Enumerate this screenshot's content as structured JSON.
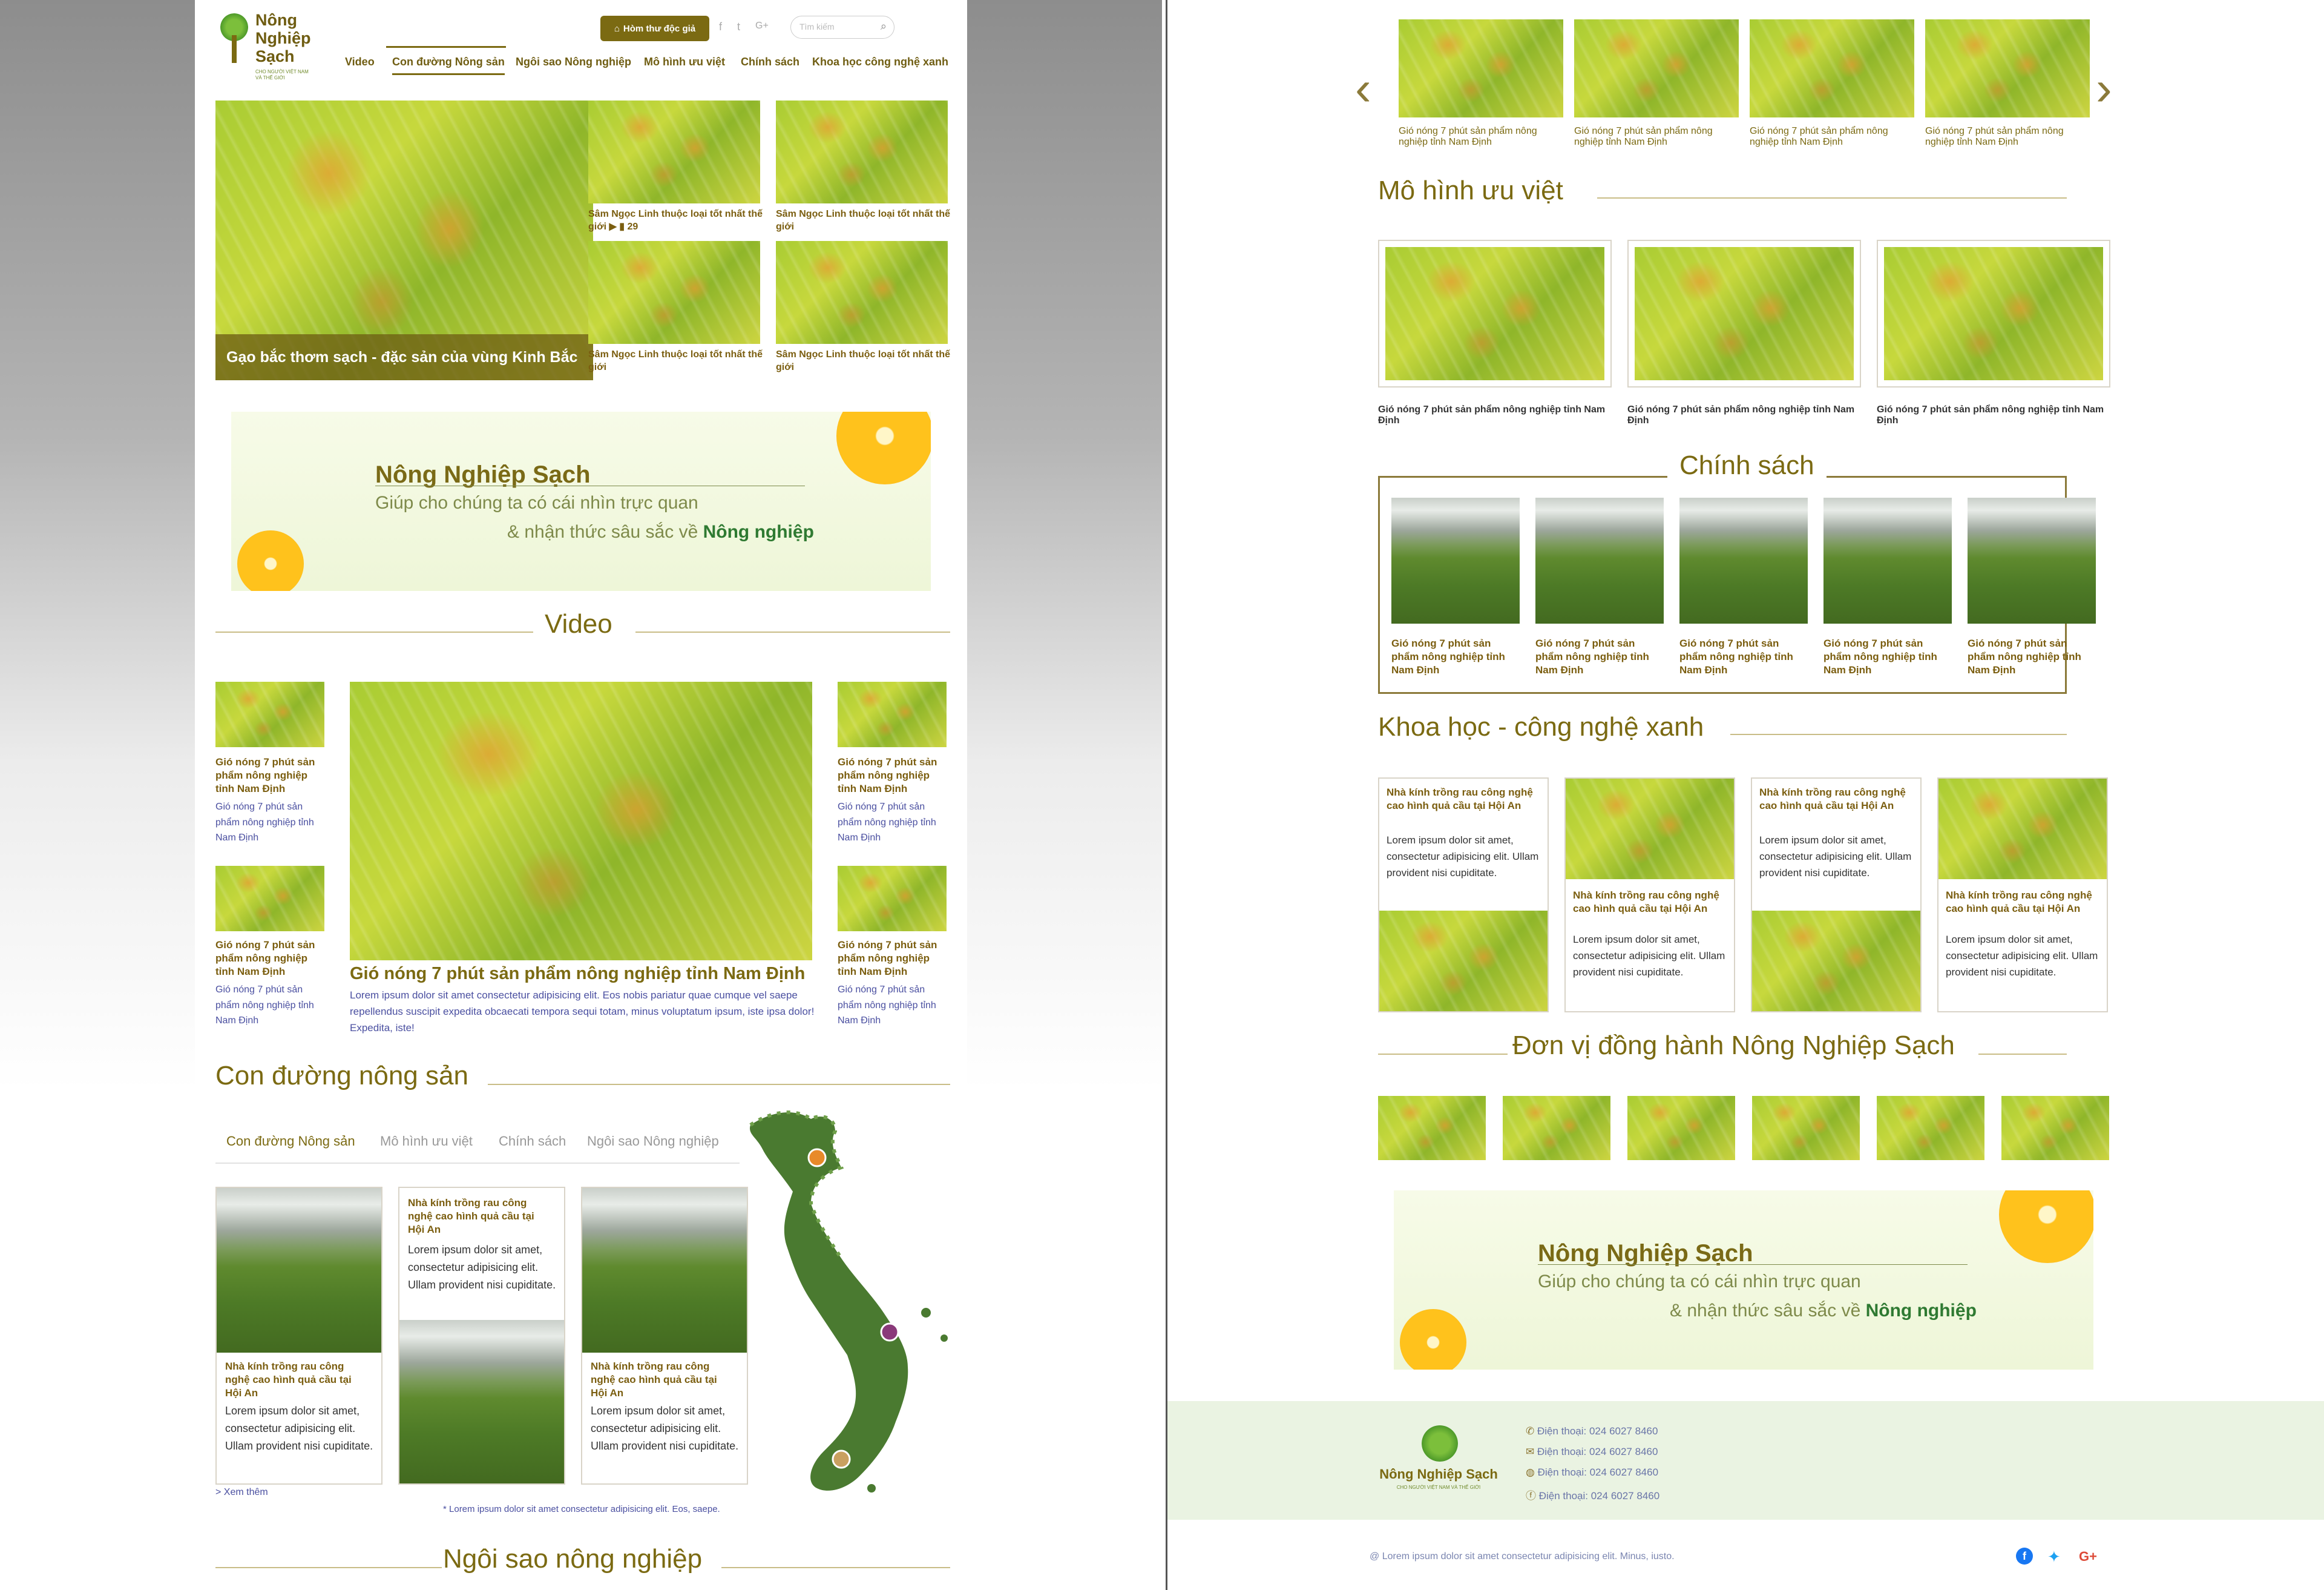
{
  "brand": {
    "name": "Nông Nghiệp Sạch",
    "name_line1": "Nông",
    "name_line2": "Nghiệp",
    "name_line3": "Sạch",
    "tagline": "CHO NGƯỜI VIỆT NAM VÀ THẾ GIỚI"
  },
  "header": {
    "mailbox_label": "Hòm thư độc giả",
    "search_placeholder": "Tìm kiếm"
  },
  "nav": {
    "items": [
      "Video",
      "Con đường Nông sản",
      "Ngôi sao Nông nghiệp",
      "Mô hình ưu việt",
      "Chính sách",
      "Khoa học công nghệ xanh"
    ],
    "active_index": 1
  },
  "hero": {
    "caption": "Gạo bắc thơm sạch - đặc sản của vùng Kinh Bắc",
    "grid": [
      {
        "title": "Sâm Ngọc Linh thuộc loại tốt nhất thế giới",
        "comments": "29"
      },
      {
        "title": "Sâm Ngọc Linh thuộc loại tốt nhất thế giới"
      },
      {
        "title": "Sâm Ngọc Linh thuộc loại tốt nhất thế giới"
      },
      {
        "title": "Sâm Ngọc Linh thuộc loại tốt nhất thế giới"
      }
    ]
  },
  "banner": {
    "title": "Nông Nghiệp Sạch",
    "line1": "Giúp cho chúng ta có cái nhìn trực quan",
    "line2_prefix": "& nhận thức sâu sắc về ",
    "line2_emphasis": "Nông nghiệp"
  },
  "video": {
    "heading": "Video",
    "side_title": "Gió nóng 7 phút sản phẩm nông nghiệp tỉnh Nam Định",
    "side_sub": "Gió nóng 7 phút sản phẩm nông nghiệp tỉnh Nam Định",
    "main_title": "Gió nóng 7 phút sản phẩm nông nghiệp tỉnh Nam Định",
    "main_text": "Lorem ipsum dolor sit amet consectetur adipisicing elit. Eos nobis pariatur quae cumque vel saepe repellendus suscipit expedita obcaecati tempora sequi totam, minus voluptatum ipsum, iste ipsa dolor! Expedita, iste!"
  },
  "road": {
    "heading": "Con đường nông sản",
    "tabs": [
      "Con đường Nông sản",
      "Mô hình ưu việt",
      "Chính sách",
      "Ngôi sao Nông nghiệp"
    ],
    "card_title": "Nhà kính trồng rau công nghệ cao hình quả cầu tại Hội An",
    "card_text": "Lorem ipsum dolor sit amet, consectetur adipisicing elit. Ullam provident nisi cupiditate.",
    "more": "> Xem thêm",
    "footnote": "* Lorem ipsum dolor sit amet consectetur adipisicing elit. Eos, saepe."
  },
  "stars": {
    "heading": "Ngôi sao nông nghiệp"
  },
  "carousel": {
    "caption": "Gió nóng 7 phút sản phẩm nông nghiệp tỉnh Nam Định"
  },
  "models": {
    "heading": "Mô hình ưu việt",
    "caption": "Gió nóng 7 phút sản phẩm nông nghiệp tỉnh Nam Định"
  },
  "policy": {
    "heading": "Chính sách",
    "caption": "Gió nóng 7 phút sản phẩm nông nghiệp tỉnh Nam Định"
  },
  "science": {
    "heading": "Khoa học - công nghệ xanh",
    "card_title": "Nhà kính trồng rau công nghệ cao hình quả cầu tại Hội An",
    "card_text": "Lorem ipsum dolor sit amet, consectetur adipisicing elit. Ullam provident nisi cupiditate."
  },
  "partners": {
    "heading": "Đơn vị đồng hành Nông Nghiệp Sạch"
  },
  "footer": {
    "phone_label": "Điện thoại: 024 6027 8460",
    "copyright": "@ Lorem ipsum dolor sit amet consectetur adipisicing elit. Minus, iusto."
  },
  "colors": {
    "brand": "#7b6a12",
    "accent_green": "#2f7a32",
    "link": "#4a4fa0"
  }
}
